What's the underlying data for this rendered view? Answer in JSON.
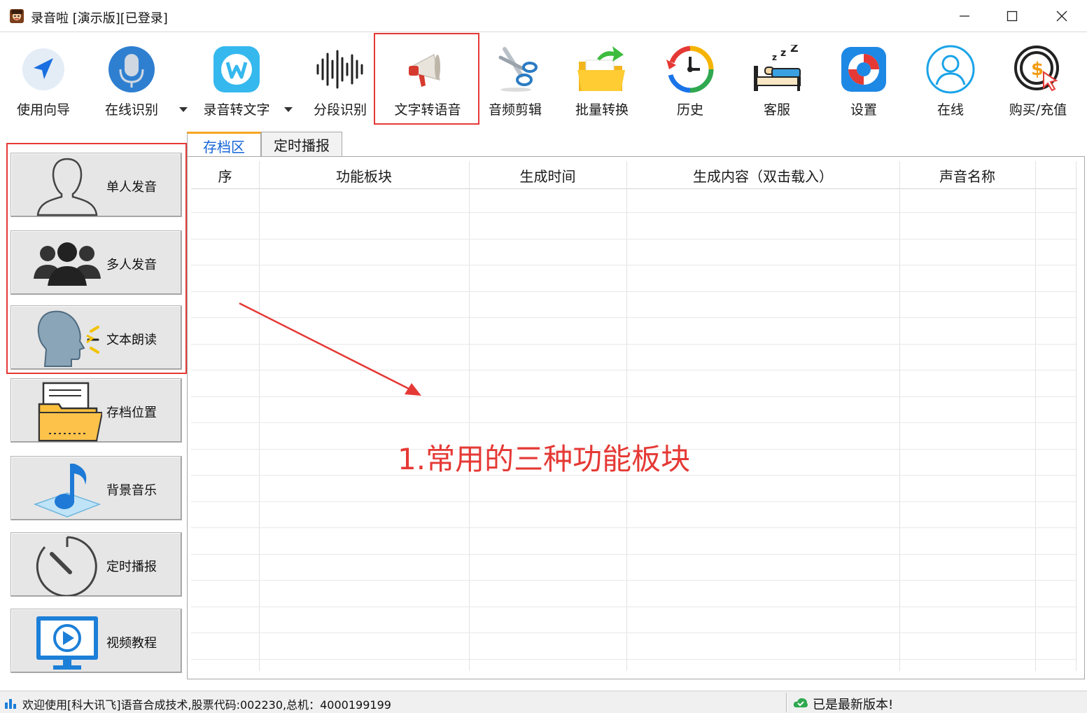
{
  "window": {
    "title": "录音啦 [演示版][已登录]"
  },
  "toolbar": {
    "items": [
      {
        "label": "使用向导",
        "icon": "navigation-arrow-icon"
      },
      {
        "label": "在线识别",
        "icon": "microphone-icon"
      },
      {
        "label": "录音转文字",
        "icon": "w-letter-icon"
      },
      {
        "label": "分段识别",
        "icon": "waveform-icon"
      },
      {
        "label": "文字转语音",
        "icon": "megaphone-icon"
      },
      {
        "label": "音频剪辑",
        "icon": "scissors-icon"
      },
      {
        "label": "批量转换",
        "icon": "folder-arrow-icon"
      },
      {
        "label": "历史",
        "icon": "history-clock-icon"
      },
      {
        "label": "客服",
        "icon": "sleeping-bed-icon"
      },
      {
        "label": "设置",
        "icon": "lifebuoy-icon"
      },
      {
        "label": "在线",
        "icon": "user-circle-icon"
      },
      {
        "label": "购买/充值",
        "icon": "dollar-cursor-icon"
      }
    ]
  },
  "sidebar": {
    "items": [
      {
        "label": "单人发音",
        "icon": "single-person-icon"
      },
      {
        "label": "多人发音",
        "icon": "group-people-icon"
      },
      {
        "label": "文本朗读",
        "icon": "speaking-head-icon"
      },
      {
        "label": "存档位置",
        "icon": "folder-document-icon"
      },
      {
        "label": "背景音乐",
        "icon": "music-note-icon"
      },
      {
        "label": "定时播报",
        "icon": "stopwatch-icon"
      },
      {
        "label": "视频教程",
        "icon": "video-monitor-icon"
      }
    ]
  },
  "tabs": [
    {
      "label": "存档区",
      "active": true
    },
    {
      "label": "定时播报",
      "active": false
    }
  ],
  "grid": {
    "columns": [
      "序",
      "功能板块",
      "生成时间",
      "生成内容（双击载入）",
      "声音名称"
    ],
    "rows": []
  },
  "annotation": {
    "text": "1.常用的三种功能板块",
    "color": "#e53935"
  },
  "status": {
    "left": "欢迎使用[科大讯飞]语音合成技术,股票代码:002230,总机：4000199199",
    "right": "已是最新版本!"
  },
  "colors": {
    "accent_red": "#e53935",
    "tab_active_text": "#1565d8",
    "tab_active_top": "#f5a623"
  }
}
